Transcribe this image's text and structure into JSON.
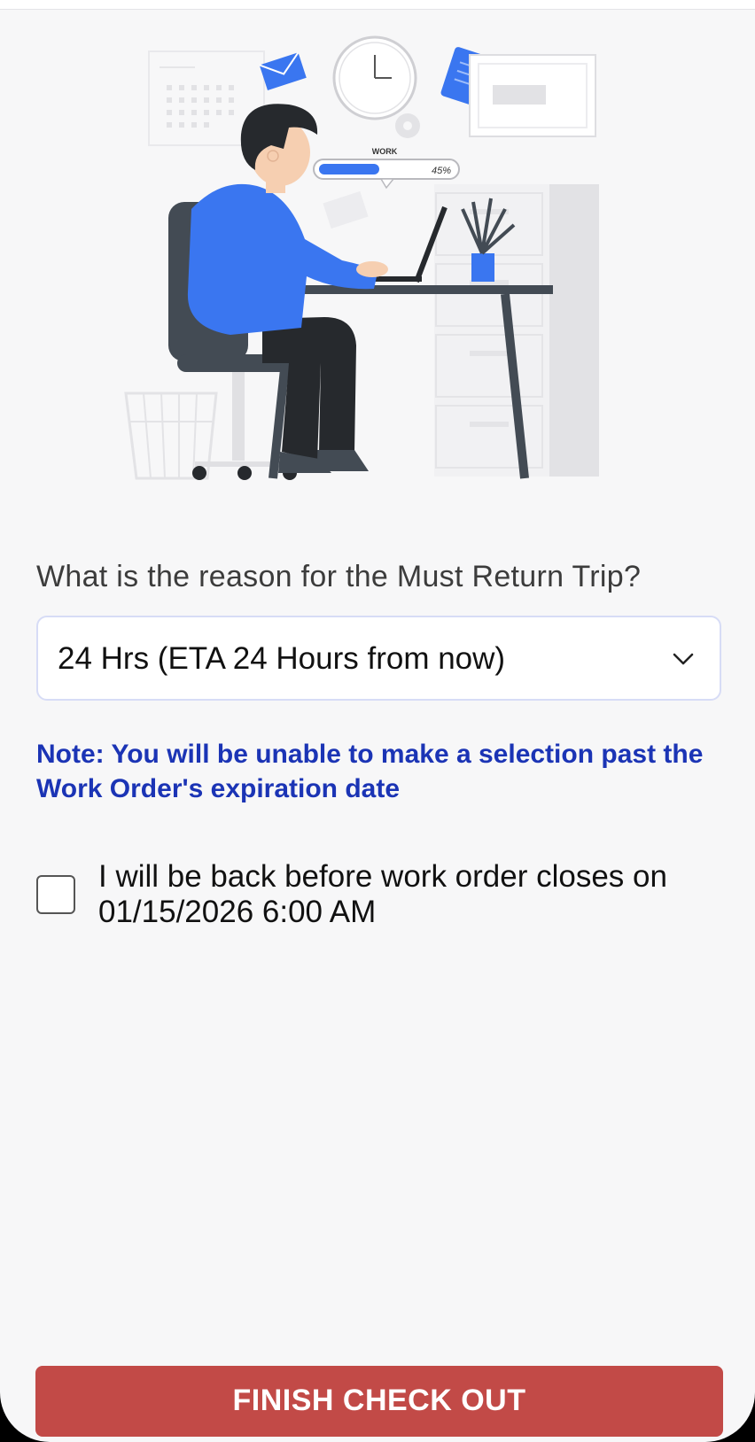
{
  "illustration": {
    "progress_label": "WORK",
    "progress_value": "45%",
    "progress_fraction": 0.45
  },
  "form": {
    "question": "What is the reason for the Must Return Trip?",
    "reason_selected": "24 Hrs (ETA 24 Hours from now)",
    "note": "Note: You will be unable to make a selection past the Work Order's expiration date",
    "return_checkbox_label": "I will be back before work order closes on 01/15/2026 6:00 AM",
    "return_checkbox_checked": false
  },
  "actions": {
    "finish_label": "FINISH CHECK OUT"
  },
  "colors": {
    "note": "#1b34b5",
    "finish_button": "#c24a47",
    "illustration_accent": "#3a76f0"
  },
  "icons": {
    "dropdown": "chevron-down-icon"
  }
}
